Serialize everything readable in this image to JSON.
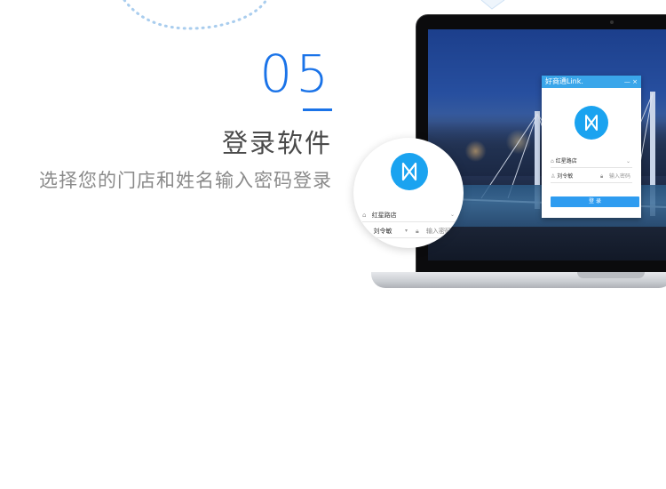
{
  "step": {
    "number": "05",
    "title": "登录软件",
    "description": "选择您的门店和姓名输入密码登录"
  },
  "login_window": {
    "app_title": "好商通Link.",
    "controls": "— ×",
    "store": "红星路店",
    "user": "刘令敏",
    "password_placeholder": "输入密码",
    "login_button": "登 录"
  },
  "magnifier": {
    "store": "红星路店",
    "user": "刘令敏",
    "password_placeholder": "输入密码"
  },
  "colors": {
    "accent": "#1a73e8",
    "logo": "#1aa3f0",
    "button": "#2e9cf0"
  },
  "icons": [
    "logo-icon",
    "store-icon",
    "user-icon",
    "lock-icon",
    "chevron-down-icon"
  ]
}
